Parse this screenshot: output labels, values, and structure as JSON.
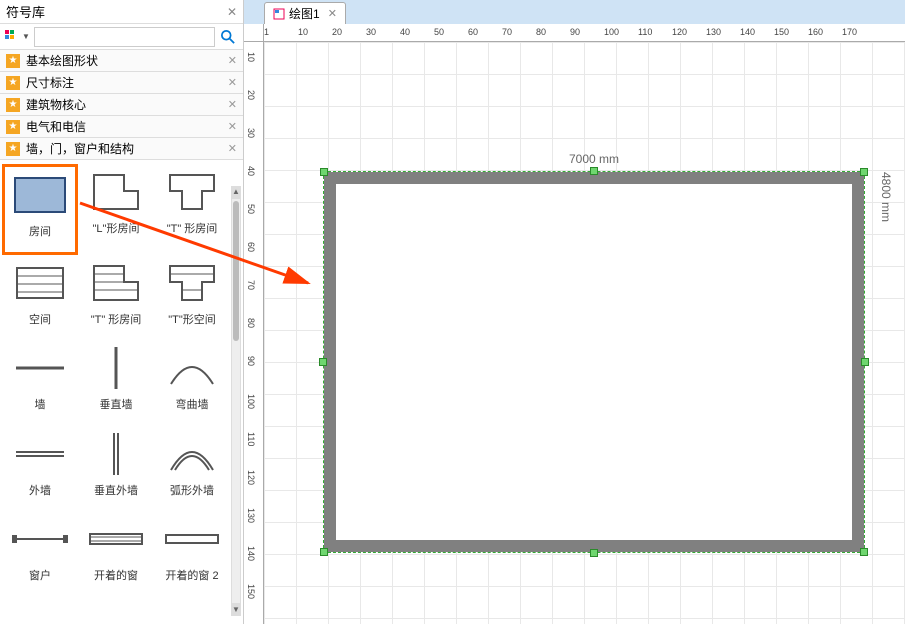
{
  "panel": {
    "title": "符号库",
    "search_placeholder": ""
  },
  "categories": [
    {
      "label": "基本绘图形状"
    },
    {
      "label": "尺寸标注"
    },
    {
      "label": "建筑物核心"
    },
    {
      "label": "电气和电信"
    },
    {
      "label": "墙，门，窗户和结构"
    }
  ],
  "shapes": [
    {
      "label": "房间",
      "icon": "rect",
      "selected": true
    },
    {
      "label": "\"L\"形房间",
      "icon": "lroom"
    },
    {
      "label": "\"T\" 形房间",
      "icon": "troom"
    },
    {
      "label": "空间",
      "icon": "hspace"
    },
    {
      "label": "\"T\" 形房间",
      "icon": "tspace"
    },
    {
      "label": "\"T\"形空间",
      "icon": "tspace2"
    },
    {
      "label": "墙",
      "icon": "hwall"
    },
    {
      "label": "垂直墙",
      "icon": "vwall"
    },
    {
      "label": "弯曲墙",
      "icon": "arc1"
    },
    {
      "label": "外墙",
      "icon": "hwall2"
    },
    {
      "label": "垂直外墙",
      "icon": "vwall2"
    },
    {
      "label": "弧形外墙",
      "icon": "arc2"
    },
    {
      "label": "窗户",
      "icon": "window"
    },
    {
      "label": "开着的窗",
      "icon": "owindow"
    },
    {
      "label": "开着的窗 2",
      "icon": "owindow2"
    }
  ],
  "tab": {
    "label": "绘图1"
  },
  "ruler_h": [
    "1",
    "10",
    "20",
    "30",
    "40",
    "50",
    "60",
    "70",
    "80",
    "90",
    "100",
    "110",
    "120",
    "130",
    "140",
    "150",
    "160",
    "170"
  ],
  "ruler_v": [
    "10",
    "20",
    "30",
    "40",
    "50",
    "60",
    "70",
    "80",
    "90",
    "100",
    "110",
    "120",
    "130",
    "140",
    "150"
  ],
  "room": {
    "width_label": "7000  mm",
    "height_label": "4800  mm"
  }
}
